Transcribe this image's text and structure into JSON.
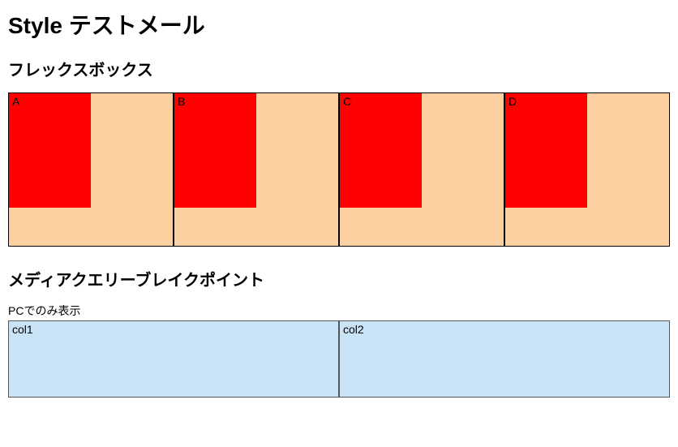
{
  "title": "Style テストメール",
  "sections": {
    "flexbox": {
      "heading": "フレックスボックス",
      "items": [
        {
          "label": "A"
        },
        {
          "label": "B"
        },
        {
          "label": "C"
        },
        {
          "label": "D"
        }
      ]
    },
    "mediaquery": {
      "heading": "メディアクエリーブレイクポイント",
      "pc_label": "PCでのみ表示",
      "columns": [
        {
          "label": "col1"
        },
        {
          "label": "col2"
        }
      ]
    }
  }
}
